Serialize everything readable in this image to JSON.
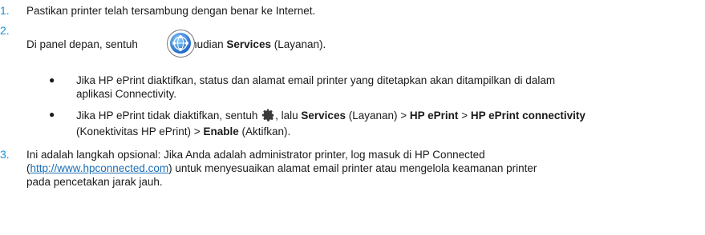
{
  "steps": [
    {
      "num": "1.",
      "text": "Pastikan printer telah tersambung dengan benar ke Internet."
    },
    {
      "num": "2.",
      "pre": "Di panel depan, sentuh ",
      "mid": ", kemudian ",
      "strong": "Services",
      "post": " (Layanan)."
    },
    {
      "num": "3.",
      "line1": "Ini adalah langkah opsional: Jika Anda adalah administrator printer, log masuk di HP Connected",
      "link_open": "(",
      "link": "http://www.hpconnected.com",
      "line2_rest": ") untuk menyesuaikan alamat email printer atau mengelola keamanan printer",
      "line3": "pada pencetakan jarak jauh."
    }
  ],
  "bullets": [
    {
      "marker": "●",
      "line1": "Jika HP ePrint diaktifkan, status dan alamat email printer yang ditetapkan akan ditampilkan di dalam",
      "line2": "aplikasi Connectivity."
    },
    {
      "marker": "●",
      "pre": "Jika HP ePrint tidak diaktifkan, sentuh ",
      "mid": ", lalu ",
      "services": "Services",
      "layanan": " (Layanan) > ",
      "eprint": "HP ePrint",
      "gt": " > ",
      "connectivity": "HP ePrint connectivity",
      "line2_pre": "(Konektivitas HP ePrint) > ",
      "enable": "Enable",
      "line2_post": " (Aktifkan)."
    }
  ],
  "icons": {
    "services": "web-services-globe-icon",
    "settings": "gear-icon"
  },
  "colors": {
    "step_number": "#1a8fd6",
    "link": "#1a6fb8",
    "icon_blue": "#2f7fd0"
  }
}
